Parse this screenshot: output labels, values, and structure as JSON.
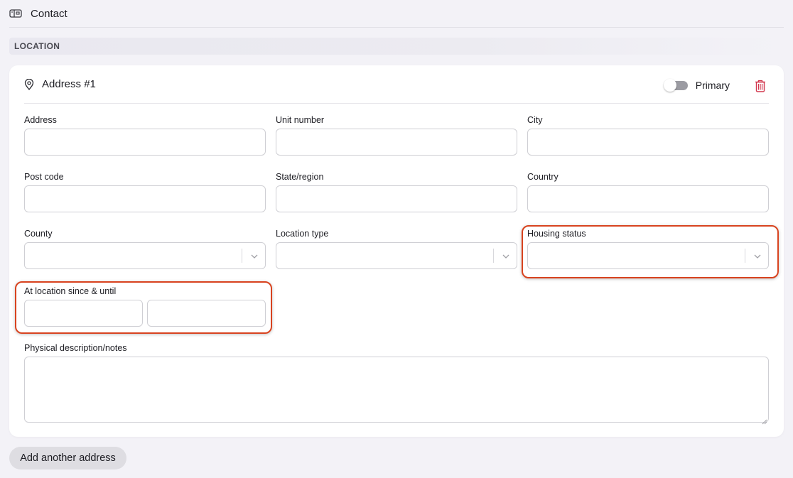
{
  "header": {
    "title": "Contact",
    "icon": "mailbox-icon"
  },
  "section": {
    "label": "LOCATION"
  },
  "address_card": {
    "title": "Address #1",
    "icon": "map-pin-icon",
    "primary_toggle": {
      "label": "Primary",
      "on": false
    },
    "delete_icon": "trash-icon",
    "delete_color": "#d2384f",
    "fields": {
      "address": {
        "label": "Address",
        "value": ""
      },
      "unit_number": {
        "label": "Unit number",
        "value": ""
      },
      "city": {
        "label": "City",
        "value": ""
      },
      "post_code": {
        "label": "Post code",
        "value": ""
      },
      "state_region": {
        "label": "State/region",
        "value": ""
      },
      "country": {
        "label": "Country",
        "value": ""
      },
      "county": {
        "label": "County",
        "value": ""
      },
      "location_type": {
        "label": "Location type",
        "value": ""
      },
      "housing_status": {
        "label": "Housing status",
        "value": ""
      },
      "at_location": {
        "label": "At location since & until",
        "since": "",
        "until": ""
      },
      "notes": {
        "label": "Physical description/notes",
        "value": ""
      }
    }
  },
  "highlight_color": "#d8431f",
  "add_button": {
    "label": "Add another address"
  }
}
